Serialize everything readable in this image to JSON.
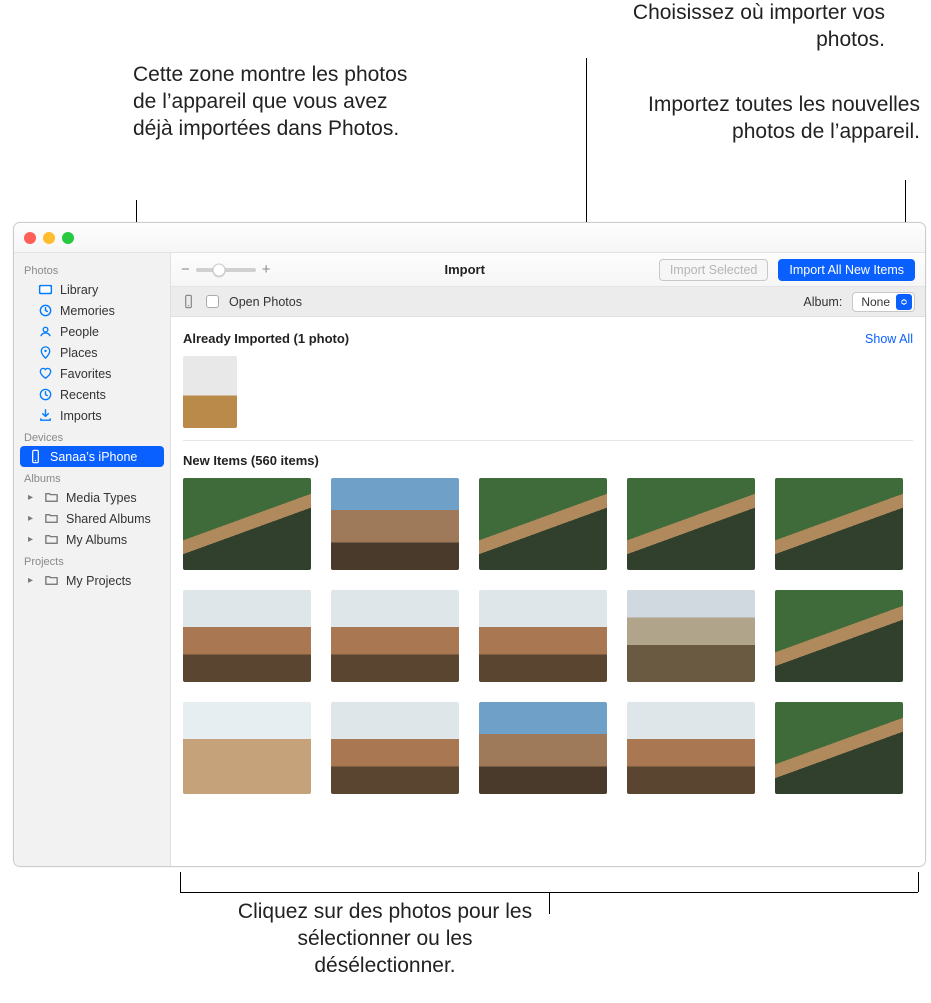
{
  "annotations": {
    "top_left": "Cette zone montre les photos de l’appareil que vous avez déjà importées dans Photos.",
    "top_right_1": "Choisissez où importer vos photos.",
    "top_right_2": "Importez toutes les nouvelles photos de l’appareil.",
    "bottom": "Cliquez sur des photos pour les sélectionner ou les désélectionner."
  },
  "toolbar": {
    "title": "Import",
    "import_selected": "Import Selected",
    "import_all": "Import All New Items",
    "zoom_minus": "−",
    "zoom_plus": "+"
  },
  "subbar": {
    "open_photos": "Open Photos",
    "album_label": "Album:",
    "album_value": "None"
  },
  "sections": {
    "already_imported_title": "Already Imported (1 photo)",
    "show_all": "Show All",
    "new_items_title": "New Items (560 items)"
  },
  "sidebar": {
    "section_photos": "Photos",
    "library": "Library",
    "memories": "Memories",
    "people": "People",
    "places": "Places",
    "favorites": "Favorites",
    "recents": "Recents",
    "imports": "Imports",
    "section_devices": "Devices",
    "device": "Sanaa’s iPhone",
    "section_albums": "Albums",
    "media_types": "Media Types",
    "shared_albums": "Shared Albums",
    "my_albums": "My Albums",
    "section_projects": "Projects",
    "my_projects": "My Projects"
  },
  "colors": {
    "accent": "#0a60ff"
  }
}
